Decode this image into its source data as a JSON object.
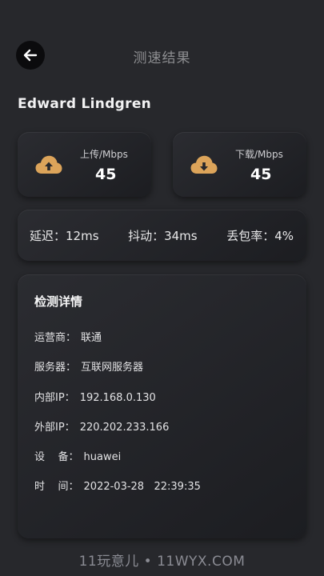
{
  "header": {
    "title": "测速结果",
    "back_icon": "arrow-left-icon"
  },
  "user": {
    "name": "Edward Lindgren"
  },
  "speed": {
    "upload": {
      "label": "上传/Mbps",
      "value": "45",
      "icon": "cloud-upload-icon"
    },
    "download": {
      "label": "下载/Mbps",
      "value": "45",
      "icon": "cloud-download-icon"
    }
  },
  "stats": {
    "latency": "延迟：12ms",
    "jitter": "抖动：34ms",
    "packet_loss": "丢包率：4%"
  },
  "details": {
    "title": "检测详情",
    "rows": [
      {
        "key": "运营商：",
        "value": "联通"
      },
      {
        "key": "服务器：",
        "value": "互联网服务器"
      },
      {
        "key": "内部IP：",
        "value": "192.168.0.130"
      },
      {
        "key": "外部IP：",
        "value": "220.202.233.166"
      },
      {
        "key": "设    备：",
        "value": "huawei"
      },
      {
        "key": "时    间：",
        "value": "2022-03-28   22:39:35"
      }
    ]
  },
  "watermark": "11玩意儿 • 11WYX.COM",
  "colors": {
    "background": "#27282c",
    "card": "#222327",
    "accent_icon": "#dca45a",
    "text": "#e9e9ea",
    "muted": "#8d8e91"
  }
}
